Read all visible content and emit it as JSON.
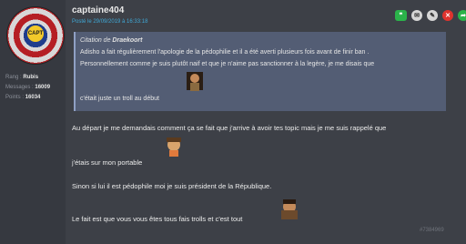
{
  "author": {
    "username": "captaine404",
    "post_date": "Posté le 29/09/2019 à 16:33:18",
    "avatar_text": "CAPT",
    "rank_label": "Rang :",
    "rank_value": "Rubis",
    "messages_label": "Messages :",
    "messages_value": "16009",
    "points_label": "Points :",
    "points_value": "16034"
  },
  "actions": [
    {
      "name": "quote-button",
      "glyph": "❞"
    },
    {
      "name": "message-button",
      "glyph": "✉"
    },
    {
      "name": "edit-button",
      "glyph": "✎"
    },
    {
      "name": "delete-button",
      "glyph": "✕"
    },
    {
      "name": "share-button",
      "glyph": "➦"
    }
  ],
  "quote": {
    "prefix": "Citation de",
    "quoted_author": "Draekoort",
    "line1": "Adisho a fait régulièrement l'apologie de la pédophilie et il a été averti plusieurs fois avant de finir ban .",
    "line2": "Personnellement comme je suis plutôt naif et que je n'aime pas sanctionner à la legère, je me disais que",
    "line3": "c'était juste un troll au début"
  },
  "body": {
    "line1": "Au départ je me demandais comment ça se fait que j'arrive à avoir tes topic mais je me suis rappelé que",
    "line2": "j'étais sur mon portable",
    "line3": "Sinon si lui il est pédophile moi je suis président de la République.",
    "line4": "Le fait est que vous vous êtes tous fais trolls et c'est tout"
  },
  "post_id": "#7384969",
  "colors": {
    "background": "#3d4047",
    "quote_bg": "#535d74",
    "date_blue": "#3fa8d6",
    "action_green": "#2bb34a",
    "action_red": "#e0332e"
  }
}
